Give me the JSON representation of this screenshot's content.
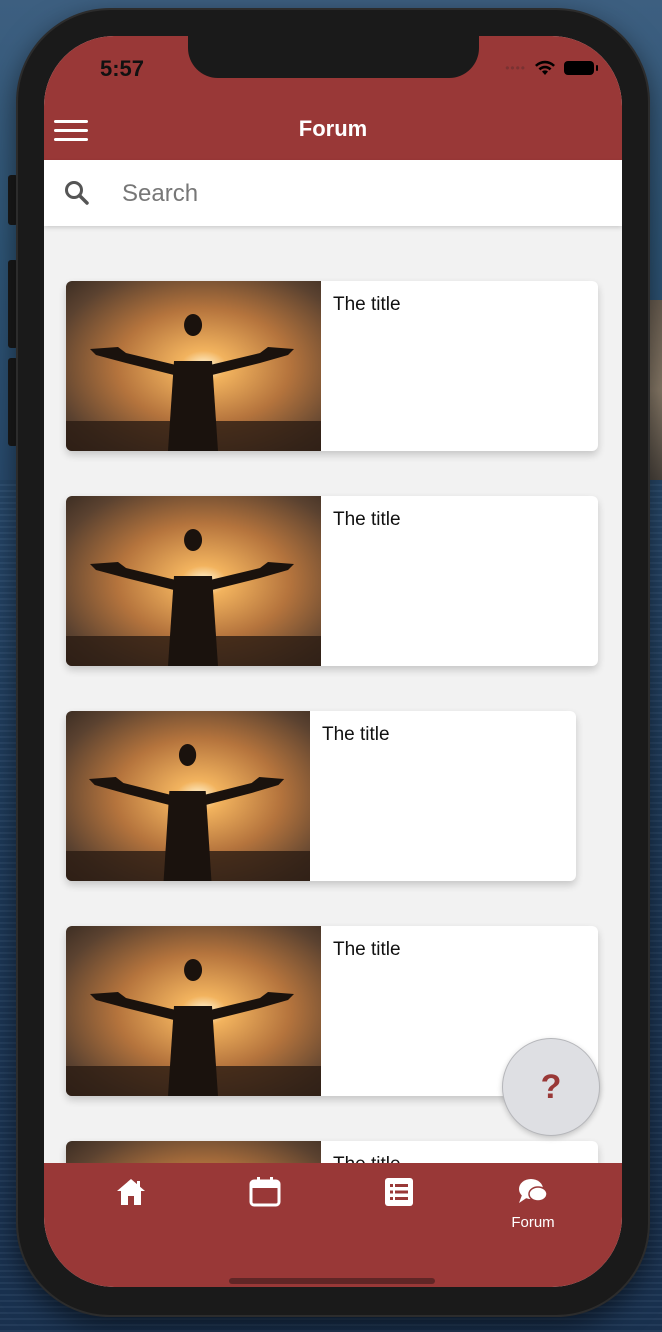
{
  "status": {
    "time": "5:57"
  },
  "header": {
    "title": "Forum"
  },
  "search": {
    "placeholder": "Search"
  },
  "posts": [
    {
      "title": "The title",
      "image": "sunset-man-silhouette"
    },
    {
      "title": "The title",
      "image": "sunset-man-silhouette"
    },
    {
      "title": "The title",
      "image": "sunset-man-silhouette"
    },
    {
      "title": "The title",
      "image": "sunset-man-silhouette"
    },
    {
      "title": "The title",
      "image": "sunset-man-silhouette"
    }
  ],
  "fab": {
    "label": "?"
  },
  "tabs": [
    {
      "icon": "home-icon",
      "label": ""
    },
    {
      "icon": "calendar-icon",
      "label": ""
    },
    {
      "icon": "list-icon",
      "label": ""
    },
    {
      "icon": "chat-bubbles-icon",
      "label": "Forum"
    }
  ],
  "colors": {
    "brand": "#993837",
    "background": "#f2f2f2",
    "card": "#ffffff"
  }
}
